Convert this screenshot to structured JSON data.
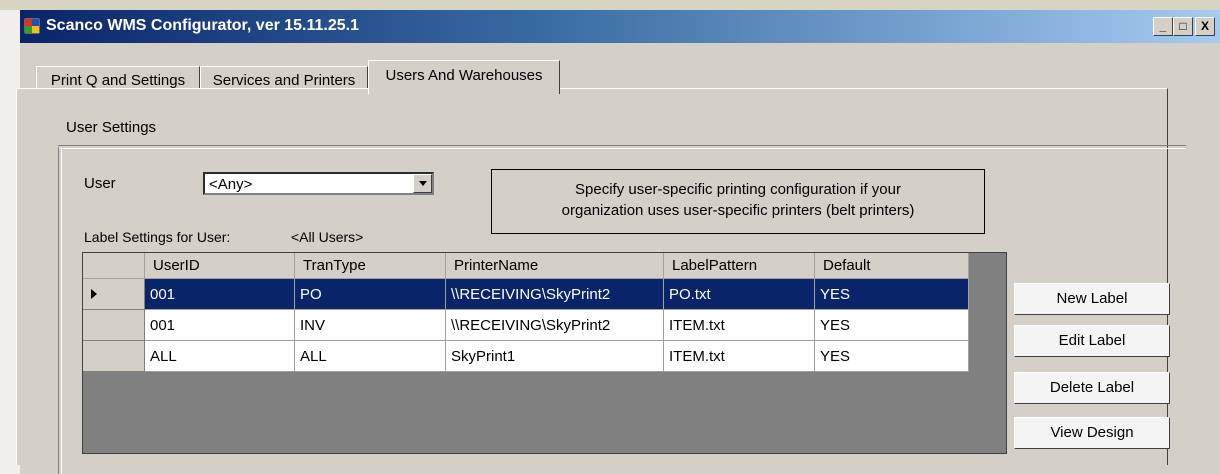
{
  "window": {
    "title": "Scanco WMS Configurator,  ver 15.11.25.1",
    "controls": {
      "minimize": "_",
      "maximize": "□",
      "close": "X"
    }
  },
  "tabs": [
    {
      "label": "Print Q and Settings",
      "active": false
    },
    {
      "label": "Services and Printers",
      "active": false
    },
    {
      "label": "Users And Warehouses",
      "active": true
    }
  ],
  "group": {
    "title": "User Settings"
  },
  "user_filter": {
    "label": "User",
    "selected": "<Any>"
  },
  "info_text_line1": "Specify user-specific printing configuration if your",
  "info_text_line2": "organization uses user-specific printers (belt printers)",
  "label_settings": {
    "label": "Label Settings for User:",
    "value": "<All Users>"
  },
  "grid": {
    "columns": [
      "UserID",
      "TranType",
      "PrinterName",
      "LabelPattern",
      "Default"
    ],
    "rows": [
      {
        "selected": true,
        "cells": [
          "001",
          "PO",
          "\\\\RECEIVING\\SkyPrint2",
          "PO.txt",
          "YES"
        ]
      },
      {
        "selected": false,
        "cells": [
          "001",
          "INV",
          "\\\\RECEIVING\\SkyPrint2",
          "ITEM.txt",
          "YES"
        ]
      },
      {
        "selected": false,
        "cells": [
          "ALL",
          "ALL",
          "SkyPrint1",
          "ITEM.txt",
          "YES"
        ]
      }
    ]
  },
  "buttons": {
    "new_label": "New Label",
    "edit_label": "Edit Label",
    "delete_label": "Delete Label",
    "view_design": "View Design"
  },
  "colors": {
    "titlebar_start": "#0a246a",
    "titlebar_end": "#a6caf0",
    "selection": "#0a246a",
    "face": "#d4d0c8"
  }
}
